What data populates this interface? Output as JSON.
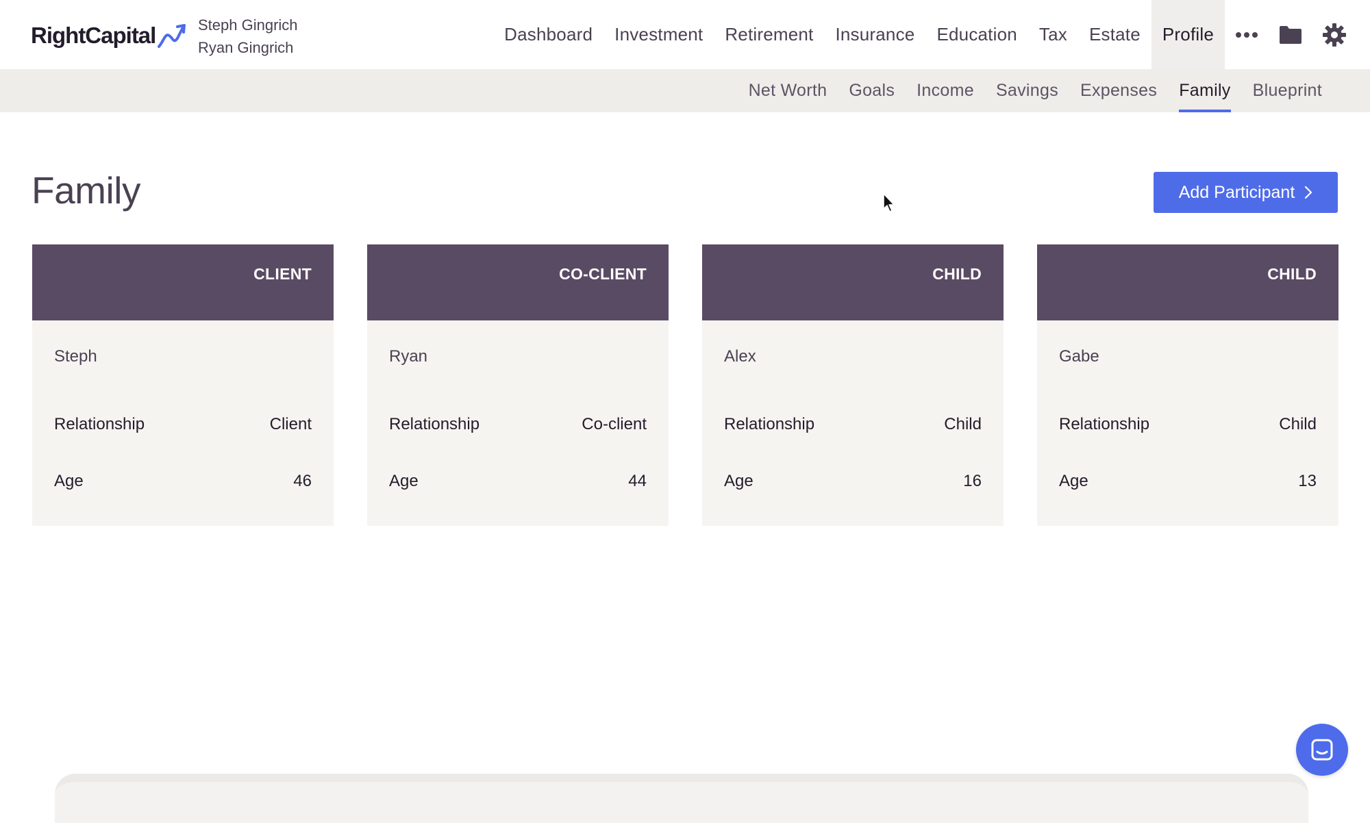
{
  "brand": {
    "name": "RightCapital",
    "accent": "#4d6bea"
  },
  "household": {
    "names": [
      "Steph Gingrich",
      "Ryan Gingrich"
    ]
  },
  "main_nav": {
    "items": [
      {
        "label": "Dashboard"
      },
      {
        "label": "Investment"
      },
      {
        "label": "Retirement"
      },
      {
        "label": "Insurance"
      },
      {
        "label": "Education"
      },
      {
        "label": "Tax"
      },
      {
        "label": "Estate"
      },
      {
        "label": "Profile",
        "active": true
      }
    ],
    "icons": [
      "more-icon",
      "folder-icon",
      "gear-icon"
    ]
  },
  "sub_nav": {
    "items": [
      {
        "label": "Net Worth"
      },
      {
        "label": "Goals"
      },
      {
        "label": "Income"
      },
      {
        "label": "Savings"
      },
      {
        "label": "Expenses"
      },
      {
        "label": "Family",
        "active": true
      },
      {
        "label": "Blueprint"
      }
    ]
  },
  "page": {
    "title": "Family",
    "add_button_label": "Add Participant"
  },
  "family": {
    "labels": {
      "relationship": "Relationship",
      "age": "Age"
    },
    "members": [
      {
        "role": "CLIENT",
        "name": "Steph",
        "relationship": "Client",
        "age": "46"
      },
      {
        "role": "CO-CLIENT",
        "name": "Ryan",
        "relationship": "Co-client",
        "age": "44"
      },
      {
        "role": "CHILD",
        "name": "Alex",
        "relationship": "Child",
        "age": "16"
      },
      {
        "role": "CHILD",
        "name": "Gabe",
        "relationship": "Child",
        "age": "13"
      }
    ]
  },
  "colors": {
    "card_header": "#5a4b64",
    "card_body": "#f6f4f1",
    "button": "#4f6ce8"
  }
}
